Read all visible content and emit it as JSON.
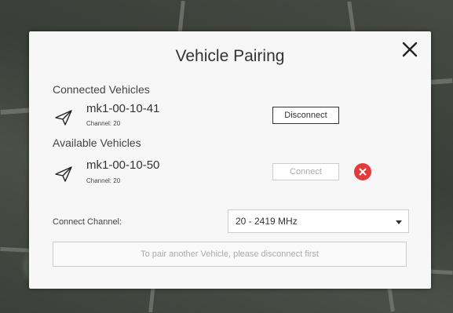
{
  "dialog": {
    "title": "Vehicle Pairing",
    "close_icon": "close-icon"
  },
  "connected": {
    "heading": "Connected Vehicles",
    "vehicles": [
      {
        "id": "mk1-00-10-41",
        "channel": "Channel: 20",
        "icon": "paper-plane-icon",
        "action_label": "Disconnect"
      }
    ]
  },
  "available": {
    "heading": "Available Vehicles",
    "vehicles": [
      {
        "id": "mk1-00-10-50",
        "channel": "Channel: 20",
        "icon": "paper-plane-icon",
        "action_label": "Connect",
        "remove_icon": "remove-icon"
      }
    ]
  },
  "channel": {
    "label": "Connect Channel:",
    "selected": "20 - 2419 MHz",
    "caret_icon": "caret-down-icon"
  },
  "hint": "To pair another Vehicle, please disconnect first",
  "colors": {
    "danger": "#e23b3b",
    "dialog_bg": "#f7f7f7",
    "text": "#333333",
    "muted": "#aaaaaa"
  }
}
